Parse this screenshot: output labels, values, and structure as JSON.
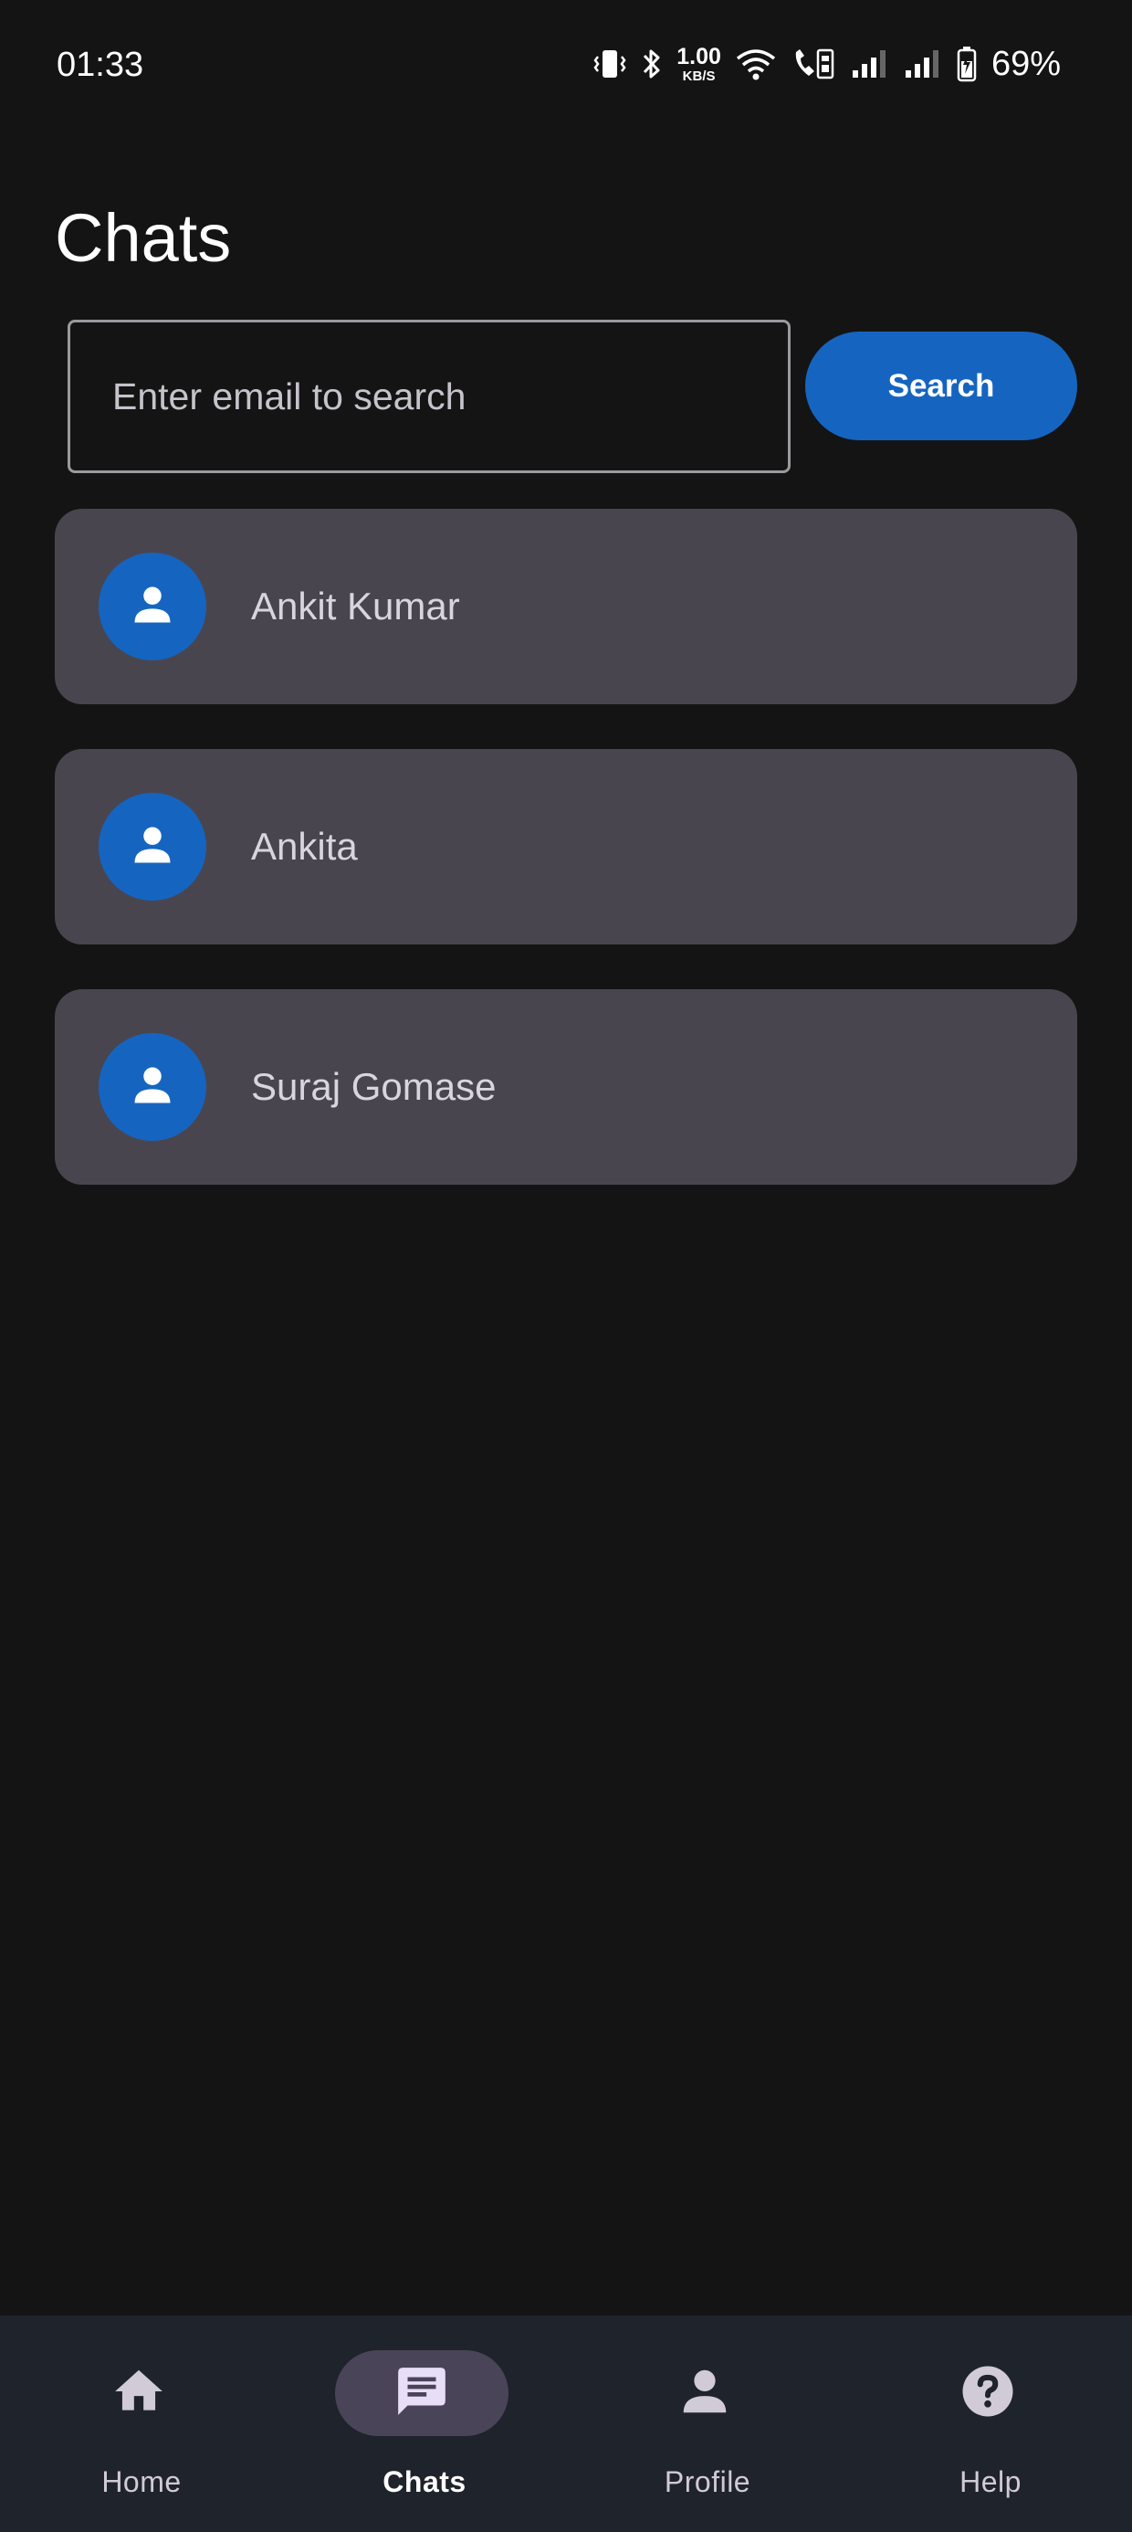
{
  "status_bar": {
    "time": "01:33",
    "net_speed_value": "1.00",
    "net_speed_unit": "KB/S",
    "battery_percent": "69%"
  },
  "page": {
    "title": "Chats"
  },
  "search": {
    "placeholder": "Enter email to search",
    "value": "",
    "button_label": "Search"
  },
  "chats": [
    {
      "name": "Ankit Kumar",
      "avatar_icon": "person-icon"
    },
    {
      "name": "Ankita",
      "avatar_icon": "person-icon"
    },
    {
      "name": "Suraj Gomase",
      "avatar_icon": "person-icon"
    }
  ],
  "bottom_nav": {
    "items": [
      {
        "label": "Home",
        "icon": "home-icon",
        "active": false
      },
      {
        "label": "Chats",
        "icon": "chat-icon",
        "active": true
      },
      {
        "label": "Profile",
        "icon": "person-icon",
        "active": false
      },
      {
        "label": "Help",
        "icon": "help-icon",
        "active": false
      }
    ]
  },
  "colors": {
    "background": "#141414",
    "card": "#49454f",
    "accent": "#1565c0",
    "nav_background": "#1f232b",
    "nav_active_pill": "#4a4458"
  }
}
